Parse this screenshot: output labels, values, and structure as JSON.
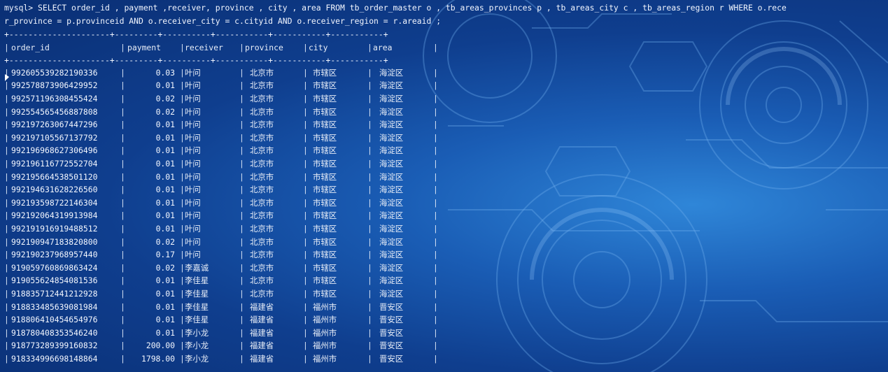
{
  "terminal": {
    "prompt_line_1": "mysql> SELECT order_id , payment ,receiver, province , city , area FROM tb_order_master o , tb_areas_provinces p , tb_areas_city c , tb_areas_region r WHERE o.rece",
    "prompt_line_2": "r_province = p.provinceid AND o.receiver_city = c.cityid AND o.receiver_region = r.areaid ;"
  },
  "table": {
    "border": "+---------------------+---------+----------+-----------+-----------+-----------+",
    "headers": [
      "order_id",
      "payment",
      "receiver",
      "province",
      "city",
      "area"
    ],
    "rows": [
      [
        "992605539282190336",
        "0.03",
        "叶问",
        "北京市",
        "市辖区",
        "海淀区"
      ],
      [
        "992578873906429952",
        "0.01",
        "叶问",
        "北京市",
        "市辖区",
        "海淀区"
      ],
      [
        "992571196308455424",
        "0.02",
        "叶问",
        "北京市",
        "市辖区",
        "海淀区"
      ],
      [
        "992554565456887808",
        "0.02",
        "叶问",
        "北京市",
        "市辖区",
        "海淀区"
      ],
      [
        "992197263067447296",
        "0.01",
        "叶问",
        "北京市",
        "市辖区",
        "海淀区"
      ],
      [
        "992197105567137792",
        "0.01",
        "叶问",
        "北京市",
        "市辖区",
        "海淀区"
      ],
      [
        "992196968627306496",
        "0.01",
        "叶问",
        "北京市",
        "市辖区",
        "海淀区"
      ],
      [
        "992196116772552704",
        "0.01",
        "叶问",
        "北京市",
        "市辖区",
        "海淀区"
      ],
      [
        "992195664538501120",
        "0.01",
        "叶问",
        "北京市",
        "市辖区",
        "海淀区"
      ],
      [
        "992194631628226560",
        "0.01",
        "叶问",
        "北京市",
        "市辖区",
        "海淀区"
      ],
      [
        "992193598722146304",
        "0.01",
        "叶问",
        "北京市",
        "市辖区",
        "海淀区"
      ],
      [
        "992192064319913984",
        "0.01",
        "叶问",
        "北京市",
        "市辖区",
        "海淀区"
      ],
      [
        "992191916919488512",
        "0.01",
        "叶问",
        "北京市",
        "市辖区",
        "海淀区"
      ],
      [
        "992190947183820800",
        "0.02",
        "叶问",
        "北京市",
        "市辖区",
        "海淀区"
      ],
      [
        "992190237968957440",
        "0.17",
        "叶问",
        "北京市",
        "市辖区",
        "海淀区"
      ],
      [
        "919059760869863424",
        "0.02",
        "李嘉诚",
        "北京市",
        "市辖区",
        "海淀区"
      ],
      [
        "919055624854081536",
        "0.01",
        "李佳星",
        "北京市",
        "市辖区",
        "海淀区"
      ],
      [
        "918835712441212928",
        "0.01",
        "李佳星",
        "北京市",
        "市辖区",
        "海淀区"
      ],
      [
        "918833485639081984",
        "0.01",
        "李佳星",
        "福建省",
        "福州市",
        "晋安区"
      ],
      [
        "918806410454654976",
        "0.01",
        "李佳星",
        "福建省",
        "福州市",
        "晋安区"
      ],
      [
        "918780408353546240",
        "0.01",
        "李小龙",
        "福建省",
        "福州市",
        "晋安区"
      ],
      [
        "918773289399160832",
        "200.00",
        "李小龙",
        "福建省",
        "福州市",
        "晋安区"
      ],
      [
        "918334996698148864",
        "1798.00",
        "李小龙",
        "福建省",
        "福州市",
        "晋安区"
      ]
    ]
  },
  "colors": {
    "text": "#f2f6ff",
    "background_dark": "#0a2f74",
    "background_light": "#2f86d8"
  },
  "icons": {
    "cursor": "mouse-pointer-icon"
  }
}
